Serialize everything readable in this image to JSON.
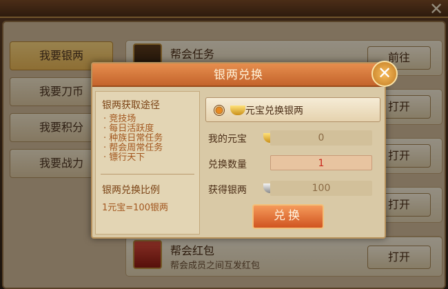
{
  "window": {
    "title": "",
    "close_glyph": "✕"
  },
  "sidebar": {
    "items": [
      {
        "label": "我要银两",
        "active": true
      },
      {
        "label": "我要刀币"
      },
      {
        "label": "我要积分"
      },
      {
        "label": "我要战力"
      }
    ]
  },
  "list": {
    "rows": [
      {
        "title": "帮会任务",
        "desc": "",
        "button": "前往",
        "icon": "gold-token-icon"
      },
      {
        "title": "",
        "desc": "",
        "button": "打开"
      },
      {
        "title": "",
        "desc": "",
        "button": "打开"
      },
      {
        "title": "",
        "desc": "",
        "button": "打开"
      },
      {
        "title": "",
        "desc": "",
        "button": "打开"
      },
      {
        "title": "帮会红包",
        "desc": "帮会成员之间互发红包",
        "button": "打开",
        "icon": "red-envelope-icon"
      }
    ]
  },
  "dialog": {
    "title": "银两兑换",
    "close_glyph": "✕",
    "sources": {
      "heading": "银两获取途径",
      "items": [
        "竞技场",
        "每日活跃度",
        "种族日常任务",
        "帮会周常任务",
        "镖行天下"
      ]
    },
    "ratio": {
      "heading": "银两兑换比例",
      "text": "1元宝=100银两"
    },
    "option": {
      "label": "元宝兑换银两"
    },
    "fields": [
      {
        "label": "我的元宝",
        "value": "0",
        "icon": "gold-ingot-icon"
      },
      {
        "label": "兑换数量",
        "value": "1"
      },
      {
        "label": "获得银两",
        "value": "100",
        "icon": "silver-ingot-icon"
      }
    ],
    "submit": "兑换"
  }
}
